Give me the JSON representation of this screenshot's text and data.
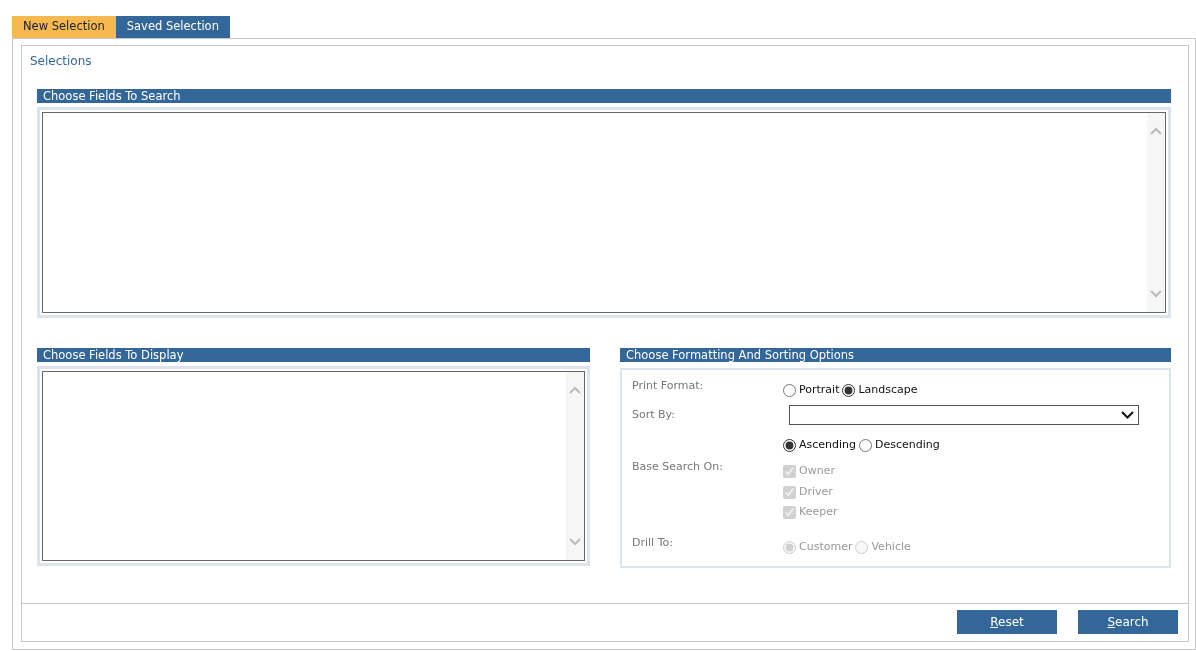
{
  "tabs": [
    {
      "label": "New Selection",
      "selected": true
    },
    {
      "label": "Saved Selection",
      "selected": false
    }
  ],
  "panel_title": "Selections",
  "search_fields": {
    "header": "Choose Fields To Search"
  },
  "display_fields": {
    "header": "Choose Fields To Display"
  },
  "options": {
    "header": "Choose Formatting And Sorting Options",
    "rows": [
      {
        "kind": "radio",
        "label": "Print Format:",
        "disabled": false,
        "options": [
          {
            "label": "Portrait",
            "selected": false
          },
          {
            "label": "Landscape",
            "selected": true
          }
        ]
      },
      {
        "kind": "select",
        "label": "Sort By:"
      },
      {
        "kind": "radio",
        "disabled": false,
        "options": [
          {
            "label": "Ascending",
            "selected": true
          },
          {
            "label": "Descending",
            "selected": false
          }
        ]
      },
      {
        "kind": "checkbox",
        "label": "Base Search On:",
        "disabled": true,
        "options": [
          {
            "label": "Owner",
            "checked": true
          },
          {
            "label": "Driver",
            "checked": true
          },
          {
            "label": "Keeper",
            "checked": true
          }
        ]
      },
      {
        "kind": "radio",
        "label": "Drill To:",
        "disabled": true,
        "options": [
          {
            "label": "Customer",
            "selected": true
          },
          {
            "label": "Vehicle",
            "selected": false
          }
        ]
      }
    ]
  },
  "buttons": [
    "Reset",
    "Search"
  ]
}
